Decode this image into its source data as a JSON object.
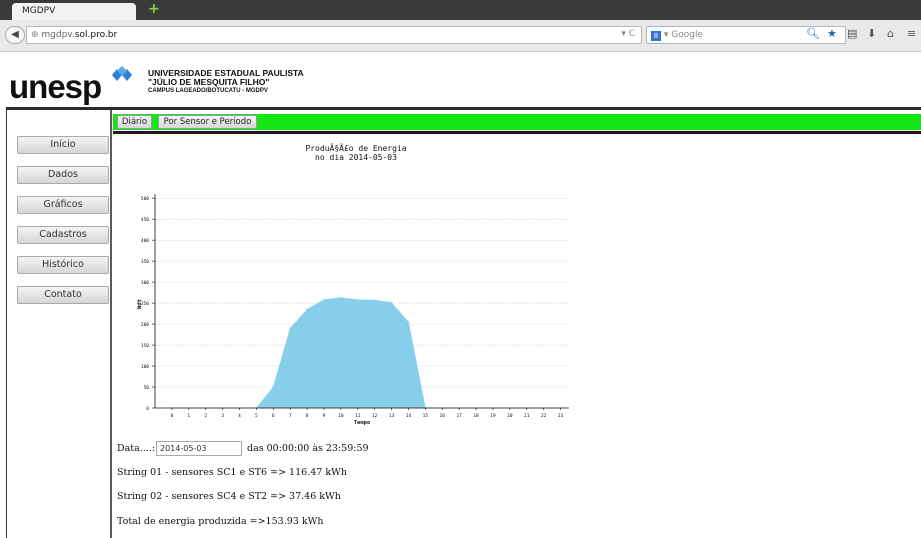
{
  "browser": {
    "tab_title": "MGDPV",
    "url_prefix": "mgdpv.",
    "url_host": "sol.pro.br",
    "url_controls": "▾ C",
    "search_placeholder": "Google"
  },
  "header": {
    "logo": "unesp",
    "line1": "UNIVERSIDADE ESTADUAL PAULISTA",
    "line2": "\"JÚLIO DE MESQUITA FILHO\"",
    "line3": "CAMPUS LAGEADO/BOTUCATU - MGDPV"
  },
  "sidebar": {
    "items": [
      {
        "label": "Início"
      },
      {
        "label": "Dados"
      },
      {
        "label": "Gráficos"
      },
      {
        "label": "Cadastros"
      },
      {
        "label": "Histórico"
      },
      {
        "label": "Contato"
      }
    ]
  },
  "tabs": {
    "diario": "Diário",
    "periodo": "Por Sensor e Período"
  },
  "chart_data": {
    "type": "area",
    "title": "ProduÃ§Ã£o de Energia",
    "subtitle": "no dia 2014-05-03",
    "xlabel": "Tempo",
    "ylabel": "Wdt",
    "x": [
      0,
      1,
      2,
      3,
      4,
      5,
      6,
      7,
      8,
      9,
      10,
      11,
      12,
      13,
      14,
      15,
      16,
      17,
      18,
      19,
      20,
      21,
      22,
      23
    ],
    "values": [
      0,
      0,
      0,
      0,
      0,
      0,
      50,
      190,
      235,
      258,
      263,
      258,
      257,
      251,
      205,
      0,
      0,
      0,
      0,
      0,
      0,
      0,
      0,
      0
    ],
    "ylim": [
      0,
      510
    ],
    "yticks": [
      0,
      50,
      100,
      150,
      200,
      250,
      300,
      350,
      400,
      450,
      500
    ],
    "grid": true,
    "color": "#87ceeb"
  },
  "info": {
    "date_label": "Data....:",
    "date_value": "2014-05-03",
    "time_range": "das 00:00:00 às 23:59:59",
    "string1": "String 01 - sensores SC1 e ST6 => 116.47 kWh",
    "string2": "String 02 - sensores SC4 e ST2 => 37.46 kWh",
    "total": "Total de energia produzida =>153.93 kWh"
  }
}
